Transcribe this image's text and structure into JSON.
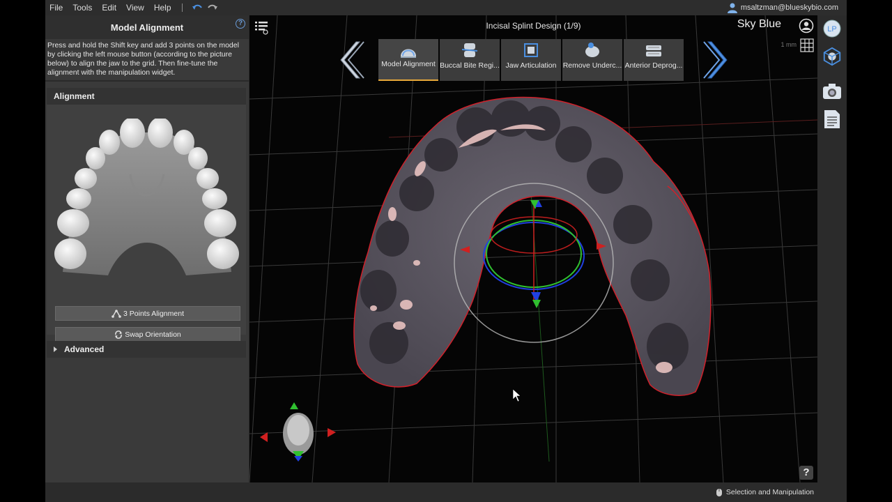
{
  "menu": {
    "items": [
      "File",
      "Tools",
      "Edit",
      "View",
      "Help"
    ]
  },
  "user": {
    "email": "msaltzman@blueskybio.com"
  },
  "left_panel": {
    "title": "Model Alignment",
    "instructions": "Press and hold the Shift key and add 3 points on the model by clicking the left mouse button (according to the picture below) to align the jaw to the grid. Then fine-tune the alignment with the manipulation widget.",
    "alignment_header": "Alignment",
    "btn_three_points": "3 Points Alignment",
    "btn_swap": "Swap Orientation",
    "advanced_header": "Advanced"
  },
  "viewport": {
    "title": "Incisal Splint Design (1/9)",
    "brand": "Sky Blue",
    "scale_label": "1 mm",
    "steps": [
      {
        "label": "Model Alignment",
        "icon": "model-alignment-icon",
        "active": true
      },
      {
        "label": "Buccal Bite Regi...",
        "icon": "buccal-bite-icon",
        "active": false
      },
      {
        "label": "Jaw Articulation",
        "icon": "jaw-articulation-icon",
        "active": false
      },
      {
        "label": "Remove Underc...",
        "icon": "remove-undercuts-icon",
        "active": false
      },
      {
        "label": "Anterior Deprog...",
        "icon": "anterior-deprogrammer-icon",
        "active": false
      }
    ],
    "help_glyph": "?"
  },
  "status": {
    "mode": "Selection and Manipulation"
  },
  "colors": {
    "accent": "#e8a93a",
    "link_blue": "#6a9bd8",
    "nav_blue": "#3f7fd0",
    "outline_red": "#d0202a"
  }
}
